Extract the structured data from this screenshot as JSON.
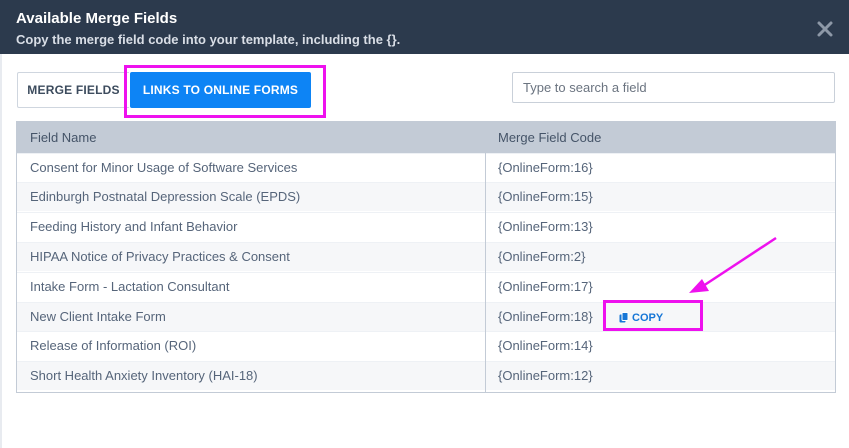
{
  "modal": {
    "title": "Available Merge Fields",
    "subtitle": "Copy the merge field code into your template, including the {}.",
    "close_icon": "close-icon"
  },
  "tabs": [
    {
      "label": "MERGE FIELDS",
      "active": false
    },
    {
      "label": "LINKS TO ONLINE FORMS",
      "active": true
    }
  ],
  "search": {
    "placeholder": "Type to search a field",
    "value": ""
  },
  "table": {
    "columns": [
      "Field Name",
      "Merge Field Code"
    ],
    "rows": [
      {
        "name": "Consent for Minor Usage of Software Services",
        "code": "{OnlineForm:16}"
      },
      {
        "name": "Edinburgh Postnatal Depression Scale (EPDS)",
        "code": "{OnlineForm:15}"
      },
      {
        "name": "Feeding History and Infant Behavior",
        "code": "{OnlineForm:13}"
      },
      {
        "name": "HIPAA Notice of Privacy Practices & Consent",
        "code": "{OnlineForm:2}"
      },
      {
        "name": "Intake Form - Lactation Consultant",
        "code": "{OnlineForm:17}"
      },
      {
        "name": "New Client Intake Form",
        "code": "{OnlineForm:18}",
        "hovered": true
      },
      {
        "name": "Release of Information (ROI)",
        "code": "{OnlineForm:14}"
      },
      {
        "name": "Short Health Anxiety Inventory (HAI-18)",
        "code": "{OnlineForm:12}"
      }
    ],
    "copy_label": "COPY",
    "copy_icon": "copy-icon"
  },
  "colors": {
    "header_bg": "#2c3a4d",
    "accent": "#0d84f5",
    "annotation": "#ee11ee"
  }
}
